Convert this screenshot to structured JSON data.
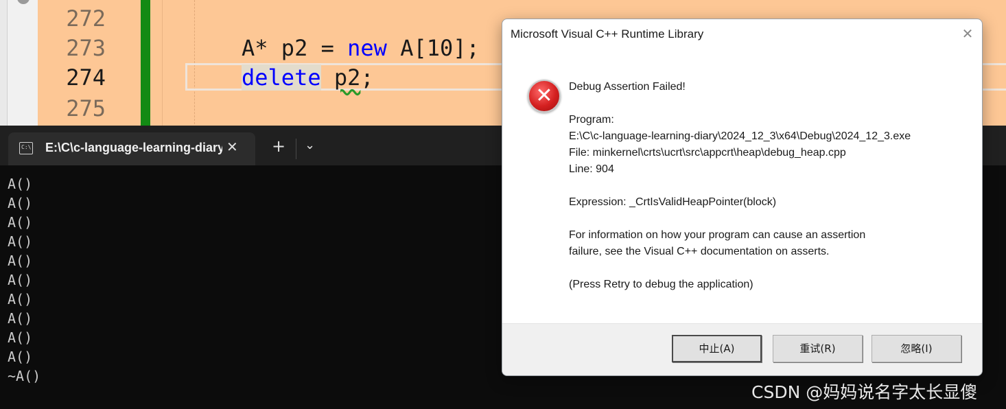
{
  "editor": {
    "line_numbers": [
      "272",
      "273",
      "274",
      "275"
    ],
    "code_273": {
      "type": "A*",
      "var": "p2",
      "eq": "=",
      "kw_new": "new",
      "rest": "A[10];"
    },
    "code_274": {
      "kw_delete": "delete",
      "var": "p2",
      "semi": ";"
    }
  },
  "terminal": {
    "tab_title": "E:\\C\\c-language-learning-diary",
    "tab_icon": "C:\\",
    "new_tab": "+",
    "dropdown": "⌄",
    "close": "✕",
    "output": [
      "A()",
      "A()",
      "A()",
      "A()",
      "A()",
      "A()",
      "A()",
      "A()",
      "A()",
      "A()",
      "~A()"
    ]
  },
  "dialog": {
    "title": "Microsoft Visual C++ Runtime Library",
    "close": "✕",
    "icon": "error-icon",
    "heading": "Debug Assertion Failed!",
    "program_label": "Program:",
    "program_path": "E:\\C\\c-language-learning-diary\\2024_12_3\\x64\\Debug\\2024_12_3.exe",
    "file_line": "File: minkernel\\crts\\ucrt\\src\\appcrt\\heap\\debug_heap.cpp",
    "line_line": "Line: 904",
    "expression": "Expression: _CrtIsValidHeapPointer(block)",
    "info_1": "For information on how your program can cause an assertion",
    "info_2": "failure, see the Visual C++ documentation on asserts.",
    "press_retry": "(Press Retry to debug the application)",
    "buttons": {
      "abort": "中止(A)",
      "retry": "重试(R)",
      "ignore": "忽略(I)"
    }
  },
  "watermark": "CSDN @妈妈说名字太长显傻"
}
